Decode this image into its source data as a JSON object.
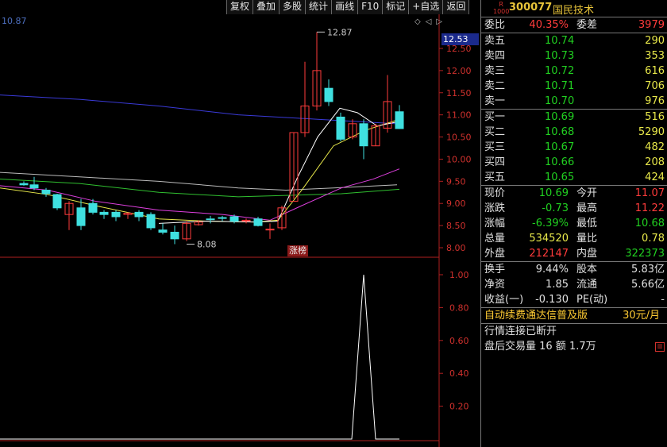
{
  "toolbar": {
    "buttons": [
      "复权",
      "叠加",
      "多股",
      "统计",
      "画线",
      "F10",
      "标记",
      "+自选",
      "返回"
    ]
  },
  "chart": {
    "indicator_top_value": "10.87",
    "high_marker": "12.87",
    "low_marker": "8.08",
    "current_price_tag": "12.53",
    "zhangbang_label": "涨榜",
    "price_axis": [
      "12.50",
      "12.00",
      "11.50",
      "11.00",
      "10.50",
      "10.00",
      "9.50",
      "9.00",
      "8.50",
      "8.00"
    ],
    "lower_axis": [
      "1.00",
      "0.80",
      "0.60",
      "0.40",
      "0.20"
    ],
    "nav_icons": [
      "diamond-outline-icon",
      "arrow-left-icon",
      "arrow-right-icon"
    ],
    "colors": {
      "up": "#ff3b3b",
      "down": "#3fe0e0",
      "ma_white": "#ffffff",
      "ma_yellow": "#e8e84a",
      "ma_magenta": "#e040e0",
      "ma_green": "#30c030",
      "ma_blue": "#3a3ad8",
      "ma_gray": "#bbbbbb"
    }
  },
  "quote": {
    "code": "300077",
    "name": "国民技术",
    "badge": "R\n1000",
    "weibi_label": "委比",
    "weibi": "40.35%",
    "weicha_label": "委差",
    "weicha": "3979",
    "asks": [
      {
        "label": "卖五",
        "price": "10.74",
        "vol": "290"
      },
      {
        "label": "卖四",
        "price": "10.73",
        "vol": "353"
      },
      {
        "label": "卖三",
        "price": "10.72",
        "vol": "616"
      },
      {
        "label": "卖二",
        "price": "10.71",
        "vol": "706"
      },
      {
        "label": "卖一",
        "price": "10.70",
        "vol": "976"
      }
    ],
    "bids": [
      {
        "label": "买一",
        "price": "10.69",
        "vol": "516"
      },
      {
        "label": "买二",
        "price": "10.68",
        "vol": "5290"
      },
      {
        "label": "买三",
        "price": "10.67",
        "vol": "482"
      },
      {
        "label": "买四",
        "price": "10.66",
        "vol": "208"
      },
      {
        "label": "买五",
        "price": "10.65",
        "vol": "424"
      }
    ],
    "stats": [
      {
        "l1": "现价",
        "v1": "10.69",
        "c1": "dn",
        "l2": "今开",
        "v2": "11.07",
        "c2": "up"
      },
      {
        "l1": "涨跌",
        "v1": "-0.73",
        "c1": "dn",
        "l2": "最高",
        "v2": "11.22",
        "c2": "up"
      },
      {
        "l1": "涨幅",
        "v1": "-6.39%",
        "c1": "dn",
        "l2": "最低",
        "v2": "10.68",
        "c2": "dn"
      },
      {
        "l1": "总量",
        "v1": "534520",
        "c1": "ye",
        "l2": "量比",
        "v2": "0.78",
        "c2": "ye"
      },
      {
        "l1": "外盘",
        "v1": "212147",
        "c1": "up",
        "l2": "内盘",
        "v2": "322373",
        "c2": "dn"
      }
    ],
    "stats2": [
      {
        "l1": "换手",
        "v1": "9.44%",
        "l2": "股本",
        "v2": "5.83亿"
      },
      {
        "l1": "净资",
        "v1": "1.85",
        "l2": "流通",
        "v2": "5.66亿"
      },
      {
        "l1": "收益(一)",
        "v1": "-0.130",
        "l2": "PE(动)",
        "v2": "-"
      }
    ],
    "promo_text": "自动续费通达信普及版",
    "promo_price": "30元/月",
    "status_text": "行情连接已断开",
    "after_hours": "盘后交易量 16 额 1.7万"
  }
}
